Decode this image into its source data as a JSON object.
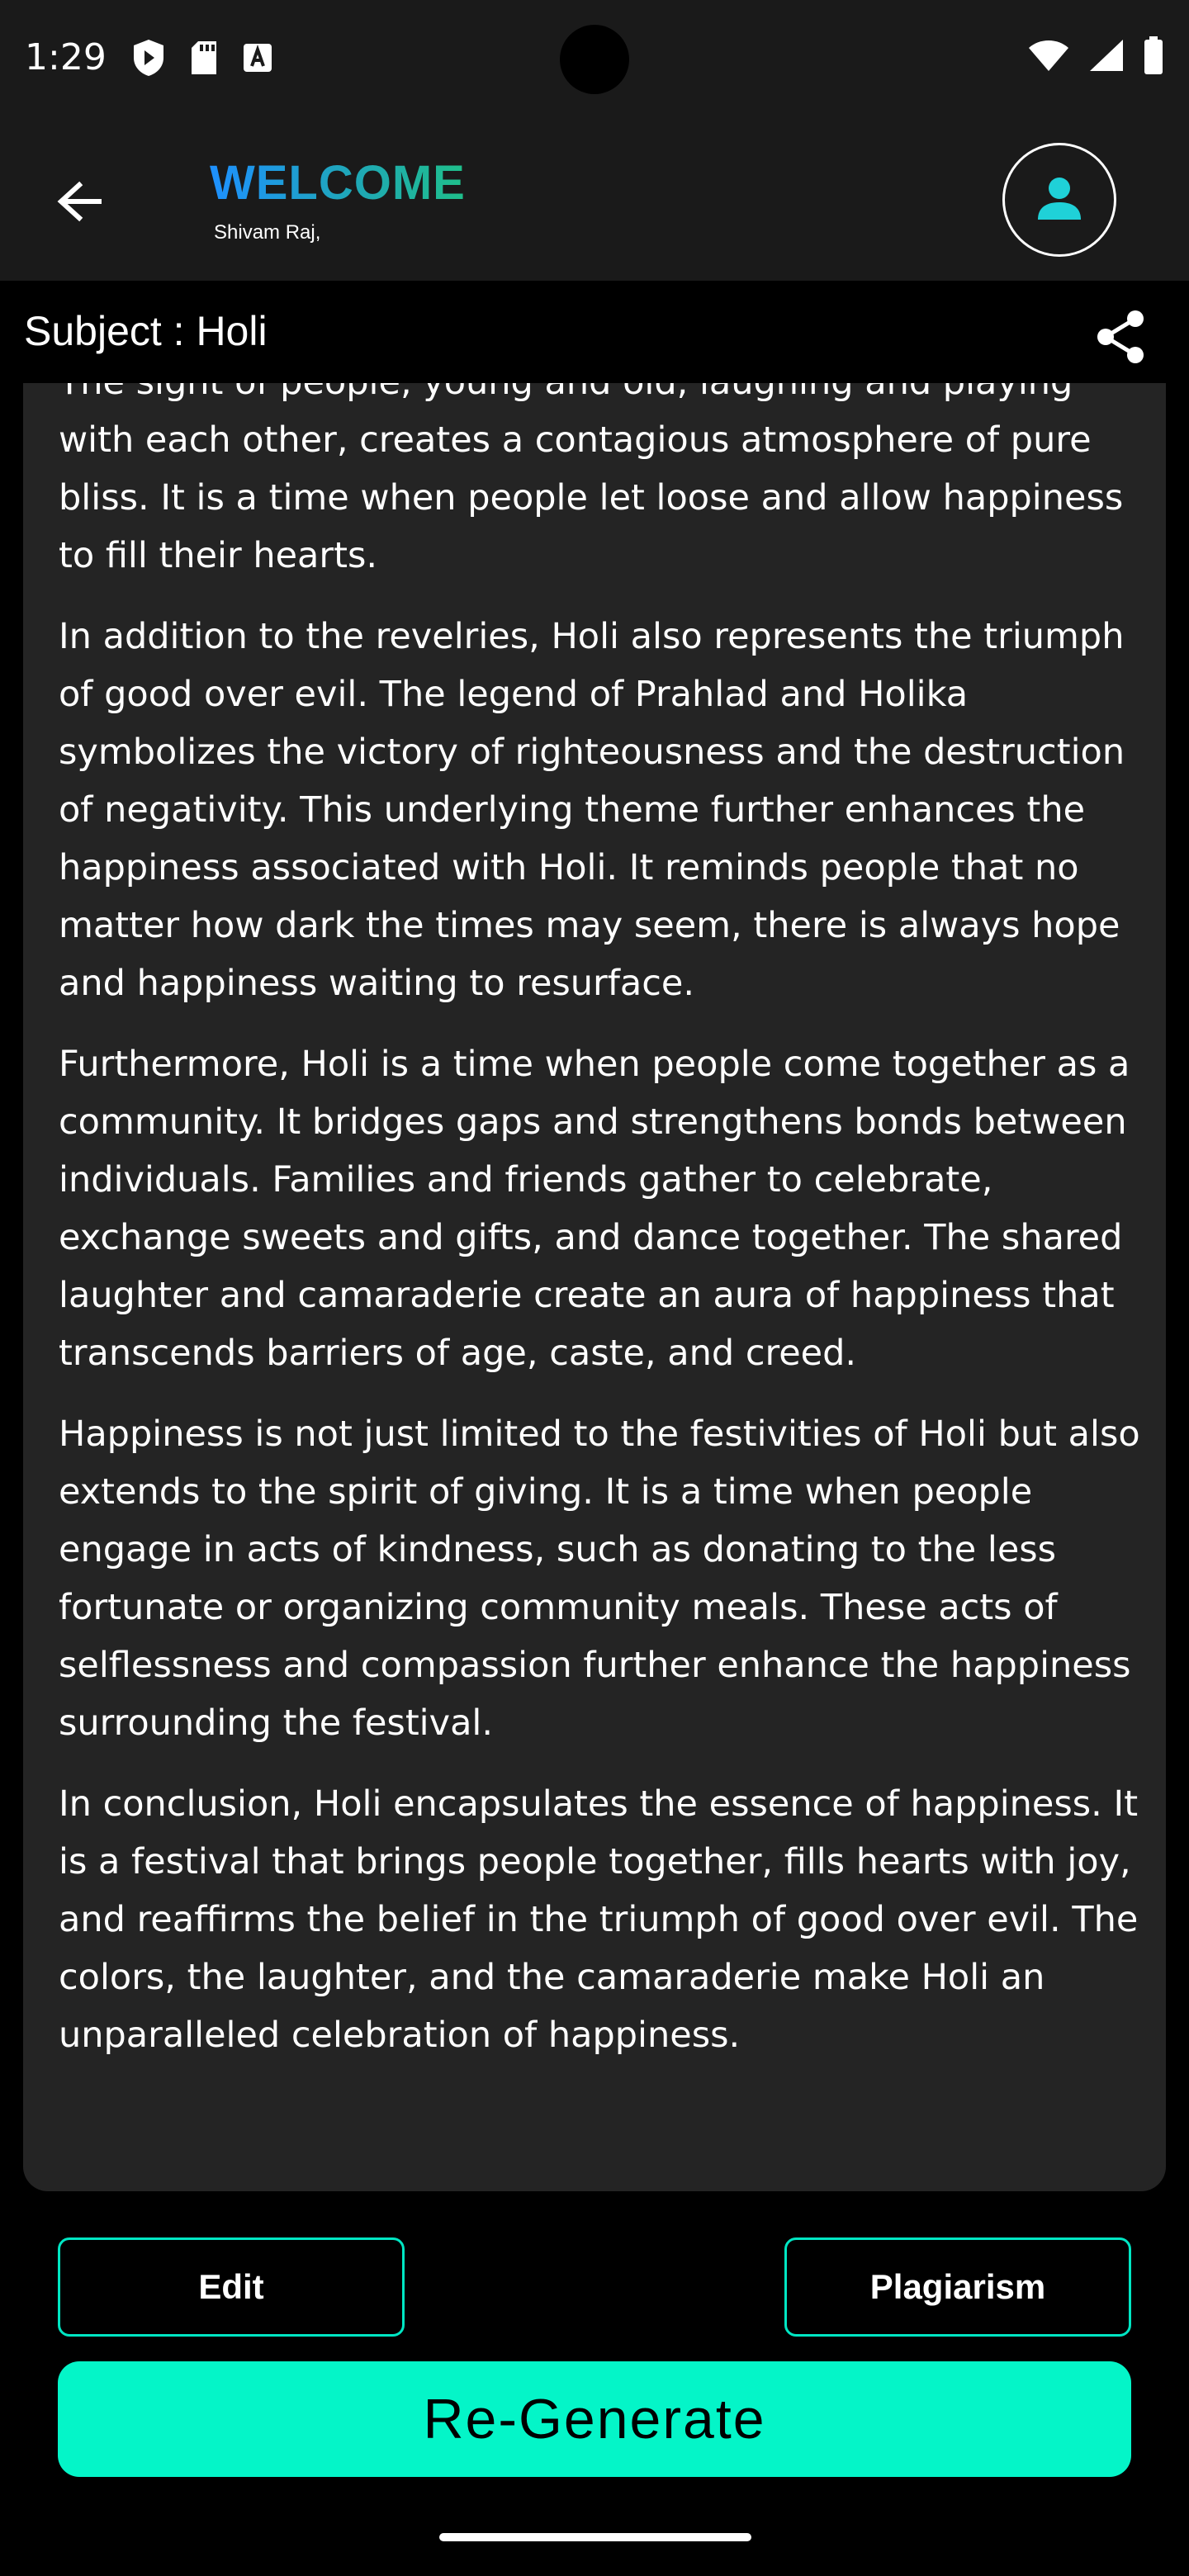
{
  "status_bar": {
    "time": "1:29"
  },
  "header": {
    "welcome": "WELCOME",
    "user_name": "Shivam Raj,"
  },
  "subject": {
    "label": "Subject : Holi"
  },
  "content": {
    "paragraphs": [
      "The sight of people, young and old, laughing and playing with each other, creates a contagious atmosphere of pure bliss. It is a time when people let loose and allow happiness to fill their hearts.",
      "In addition to the revelries, Holi also represents the triumph of good over evil. The legend of Prahlad and Holika symbolizes the victory of righteousness and the destruction of negativity. This underlying theme further enhances the happiness associated with Holi. It reminds people that no matter how dark the times may seem, there is always hope and happiness waiting to resurface.",
      "Furthermore, Holi is a time when people come together as a community. It bridges gaps and strengthens bonds between individuals. Families and friends gather to celebrate, exchange sweets and gifts, and dance together. The shared laughter and camaraderie create an aura of happiness that transcends barriers of age, caste, and creed.",
      "Happiness is not just limited to the festivities of Holi but also extends to the spirit of giving. It is a time when people engage in acts of kindness, such as donating to the less fortunate or organizing community meals. These acts of selflessness and compassion further enhance the happiness surrounding the festival.",
      "In conclusion, Holi encapsulates the essence of happiness. It is a festival that brings people together, fills hearts with joy, and reaffirms the belief in the triumph of good over evil. The colors, the laughter, and the camaraderie make Holi an unparalleled celebration of happiness."
    ]
  },
  "actions": {
    "edit": "Edit",
    "plagiarism": "Plagiarism",
    "regenerate": "Re-Generate"
  },
  "colors": {
    "accent": "#04f5c8",
    "welcome_gradient_start": "#1e90ff",
    "welcome_gradient_end": "#1fbf8a",
    "card_background": "#242424"
  },
  "icons": {
    "back": "arrow-left-icon",
    "avatar": "person-icon",
    "share": "share-icon"
  }
}
